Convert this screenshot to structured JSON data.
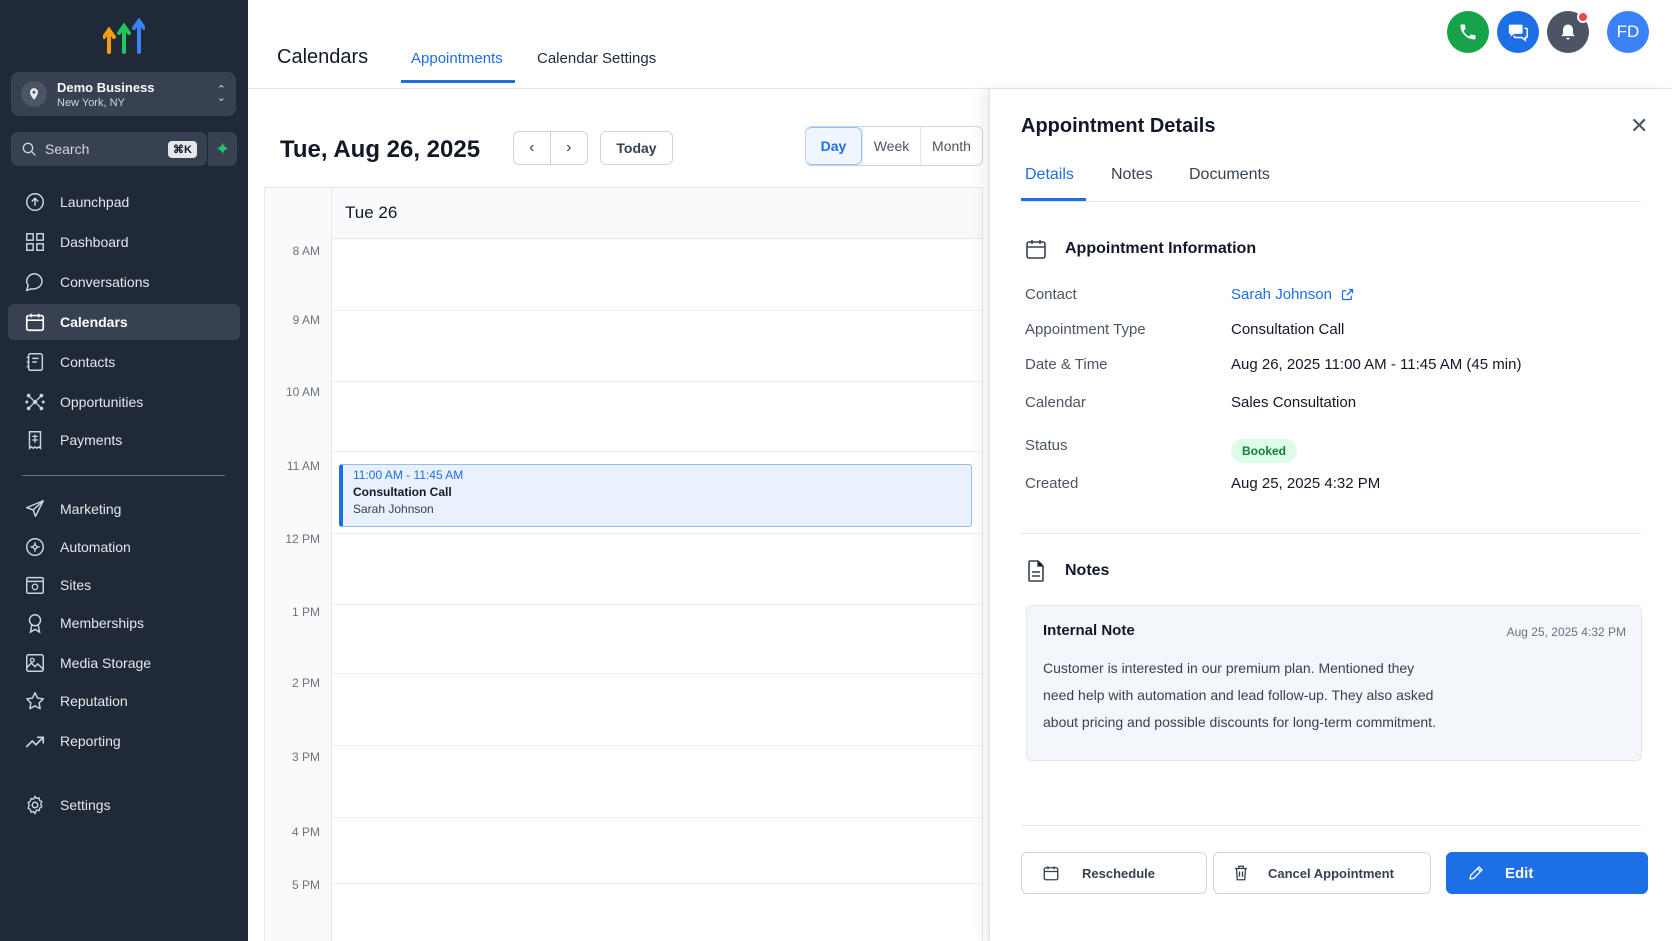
{
  "sidebar": {
    "business": {
      "name": "Demo Business",
      "location": "New York, NY"
    },
    "search": {
      "placeholder": "Search",
      "shortcut": "⌘K"
    },
    "items": [
      {
        "label": "Launchpad",
        "icon": "launchpad-icon"
      },
      {
        "label": "Dashboard",
        "icon": "dashboard-icon"
      },
      {
        "label": "Conversations",
        "icon": "chat-icon"
      },
      {
        "label": "Calendars",
        "icon": "calendar-icon",
        "active": true
      },
      {
        "label": "Contacts",
        "icon": "contacts-icon"
      },
      {
        "label": "Opportunities",
        "icon": "opportunities-icon"
      },
      {
        "label": "Payments",
        "icon": "payments-icon"
      },
      {
        "label": "Marketing",
        "icon": "send-icon"
      },
      {
        "label": "Automation",
        "icon": "automation-icon"
      },
      {
        "label": "Sites",
        "icon": "sites-icon"
      },
      {
        "label": "Memberships",
        "icon": "badge-icon"
      },
      {
        "label": "Media Storage",
        "icon": "image-icon"
      },
      {
        "label": "Reputation",
        "icon": "star-icon"
      },
      {
        "label": "Reporting",
        "icon": "trend-icon"
      },
      {
        "label": "Settings",
        "icon": "gear-icon"
      }
    ]
  },
  "header": {
    "title": "Calendars",
    "tabs": [
      {
        "label": "Appointments",
        "active": true
      },
      {
        "label": "Calendar Settings"
      }
    ],
    "avatar_initials": "FD"
  },
  "calendar": {
    "date_title": "Tue, Aug 26, 2025",
    "today_label": "Today",
    "views": [
      "Day",
      "Week",
      "Month"
    ],
    "active_view": "Day",
    "day_header": "Tue 26",
    "time_labels": [
      "8 AM",
      "9 AM",
      "10 AM",
      "11 AM",
      "12 PM",
      "1 PM",
      "2 PM",
      "3 PM",
      "4 PM",
      "5 PM"
    ],
    "event": {
      "time": "11:00 AM - 11:45 AM",
      "title": "Consultation Call",
      "contact": "Sarah Johnson"
    }
  },
  "details": {
    "title": "Appointment Details",
    "tabs": [
      "Details",
      "Notes",
      "Documents"
    ],
    "info_heading": "Appointment Information",
    "fields": {
      "contact_label": "Contact",
      "contact_value": "Sarah Johnson",
      "type_label": "Appointment Type",
      "type_value": "Consultation Call",
      "datetime_label": "Date & Time",
      "datetime_value": "Aug 26, 2025 11:00 AM - 11:45 AM (45 min)",
      "calendar_label": "Calendar",
      "calendar_value": "Sales Consultation",
      "status_label": "Status",
      "status_value": "Booked",
      "created_label": "Created",
      "created_value": "Aug 25, 2025 4:32 PM"
    },
    "notes_heading": "Notes",
    "note": {
      "title": "Internal Note",
      "date": "Aug 25, 2025 4:32 PM",
      "body": "Customer is interested in our premium plan. Mentioned they need help with automation and lead follow-up. They also asked about pricing and possible discounts for long-term commitment."
    },
    "buttons": {
      "reschedule": "Reschedule",
      "cancel": "Cancel Appointment",
      "edit": "Edit"
    }
  },
  "colors": {
    "accent": "#1d6fe5",
    "sidebar": "#1f2937",
    "status_green": "#15803d",
    "phone": "#16a34a"
  }
}
